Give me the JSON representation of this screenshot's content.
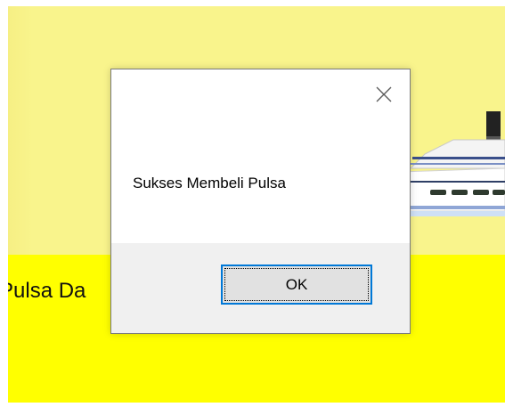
{
  "background": {
    "label": "Pulsa Da",
    "top_color": "#f9f48c",
    "bottom_color": "#ffff00"
  },
  "dialog": {
    "message": "Sukses Membeli Pulsa",
    "ok_label": "OK",
    "close_icon": "close-icon",
    "accent": "#0078d7"
  },
  "ship_icon": "ship-illustration"
}
